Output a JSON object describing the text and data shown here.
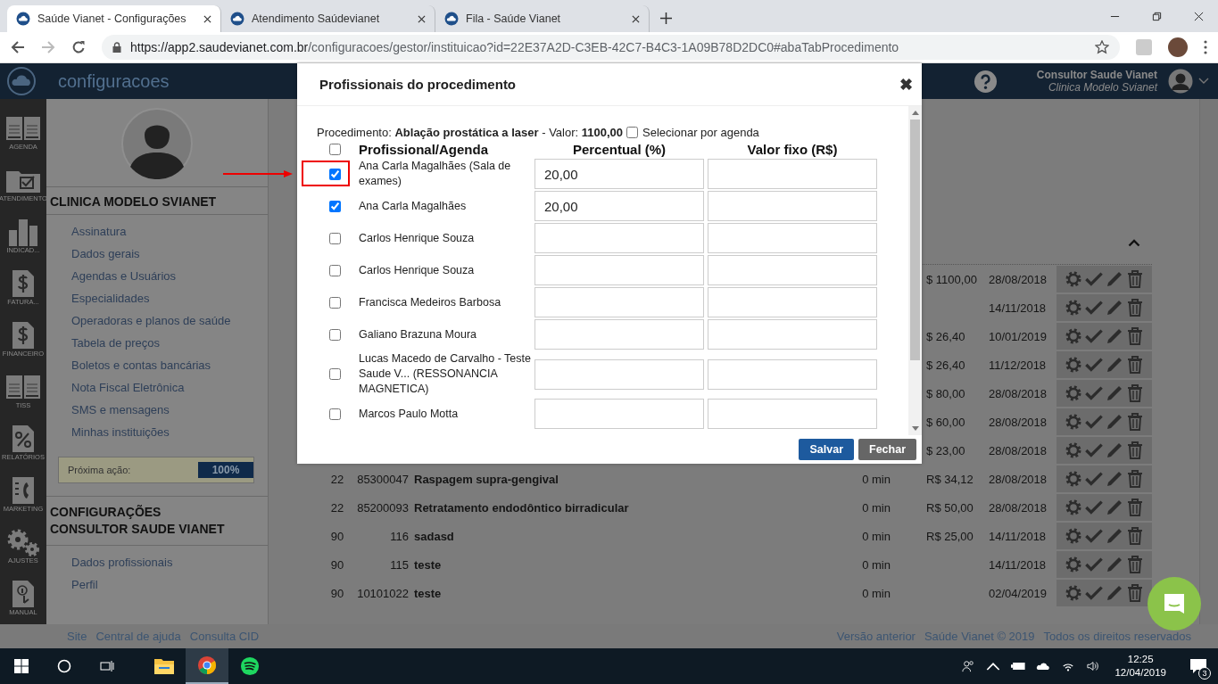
{
  "browser": {
    "tabs": [
      {
        "title": "Saúde Vianet - Configurações",
        "selected": true
      },
      {
        "title": "Atendimento Saúdevianet",
        "selected": false
      },
      {
        "title": "Fila - Saúde Vianet",
        "selected": false
      }
    ],
    "url_host": "https://app2.saudevianet.com.br",
    "url_path": "/configuracoes/gestor/instituicao?id=22E37A2D-C3EB-42C7-B4C3-1A09B78D2DC0#abaTabProcedimento"
  },
  "header": {
    "title": "configuracoes",
    "user_name": "Consultor Saude Vianet",
    "user_clinic": "Clinica Modelo Svianet"
  },
  "icon_nav": [
    {
      "label": "AGENDA",
      "kind": "calendar"
    },
    {
      "label": "ATENDIMENTO",
      "kind": "folder"
    },
    {
      "label": "INDICAD...",
      "kind": "chart"
    },
    {
      "label": "FATURA...",
      "kind": "dollar"
    },
    {
      "label": "FINANCEIRO",
      "kind": "dollar"
    },
    {
      "label": "TISS",
      "kind": "calendar"
    },
    {
      "label": "RELATÓRIOS",
      "kind": "percent"
    },
    {
      "label": "MARKETING",
      "kind": "phone"
    },
    {
      "label": "AJUSTES",
      "kind": "gears"
    },
    {
      "label": "MANUAL",
      "kind": "info"
    }
  ],
  "menu": {
    "clinic_title": "CLINICA MODELO SVIANET",
    "links": [
      "Assinatura",
      "Dados gerais",
      "Agendas e Usuários",
      "Especialidades",
      "Operadoras e planos de saúde",
      "Tabela de preços",
      "Boletos e contas bancárias",
      "Nota Fiscal Eletrônica",
      "SMS e mensagens",
      "Minhas instituições"
    ],
    "progress": {
      "label": "Próxima ação:",
      "level": 1,
      "reading": "100%"
    },
    "user_title_lines": [
      "CONFIGURAÇÕES",
      "CONSULTOR SAUDE VIANET"
    ],
    "user_links": [
      "Dados profissionais",
      "Perfil"
    ]
  },
  "table": {
    "rows": [
      {
        "price": "$ 1100,00",
        "date": "28/08/2018"
      },
      {
        "date": "14/11/2018"
      },
      {
        "price": "$ 26,40",
        "date": "10/01/2019"
      },
      {
        "price": "$ 26,40",
        "date": "11/12/2018"
      },
      {
        "price": "$ 80,00",
        "date": "28/08/2018"
      },
      {
        "price": "$ 60,00",
        "date": "28/08/2018"
      },
      {
        "price": "$ 23,00",
        "date": "28/08/2018"
      },
      {
        "col_1": "22",
        "code": "85300047",
        "name": "Raspagem supra-gengival",
        "duration": "0 min",
        "price": "R$ 34,12",
        "date": "28/08/2018"
      },
      {
        "col_1": "22",
        "code": "85200093",
        "name": "Retratamento endodôntico birradicular",
        "duration": "0 min",
        "price": "R$ 50,00",
        "date": "28/08/2018"
      },
      {
        "col_1": "90",
        "code": "116",
        "name": "sadasd",
        "duration": "0 min",
        "price": "R$ 25,00",
        "date": "14/11/2018"
      },
      {
        "col_1": "90",
        "code": "115",
        "name": "teste",
        "duration": "0 min",
        "date": "14/11/2018"
      },
      {
        "col_1": "90",
        "code": "10101022",
        "name": "teste",
        "duration": "0 min",
        "date": "02/04/2019"
      }
    ]
  },
  "footer": {
    "left_links": [
      "Site",
      "Central de ajuda",
      "Consulta CID"
    ],
    "right_links": [
      "Versão anterior",
      "Saúde Vianet © 2019",
      "Todos os direitos reservados"
    ]
  },
  "modal": {
    "title": "Profissionais do procedimento",
    "close": "✖",
    "procedure_line": "Procedimento: **Ablação prostática a laser** - Valor: **1100,00**",
    "select_by_agenda": {
      "label": "Selecionar por agenda",
      "checked": false
    },
    "select_all_checked": false,
    "columns": [
      "Profissional/Agenda",
      "Percentual (%)",
      "Valor fixo (R$)"
    ],
    "rows": [
      {
        "name": "Ana Carla Magalhães (Sala de exames)",
        "checked": true,
        "percent": "20,00",
        "highlighted": true
      },
      {
        "name": "Ana Carla Magalhães",
        "checked": true,
        "percent": "20,00",
        "highlighted": false
      },
      {
        "name": "Carlos Henrique Souza",
        "checked": false,
        "highlighted": false
      },
      {
        "name": "Carlos Henrique Souza",
        "checked": false,
        "highlighted": false
      },
      {
        "name": "Francisca Medeiros Barbosa",
        "checked": false,
        "highlighted": false
      },
      {
        "name": "Galiano Brazuna Moura",
        "checked": false,
        "highlighted": false
      },
      {
        "name": "Lucas Macedo de Carvalho - Teste Saude V... (RESSONANCIA MAGNETICA)",
        "checked": false,
        "highlighted": false
      },
      {
        "name": "Marcos Paulo Motta",
        "checked": false,
        "highlighted": false
      }
    ],
    "buttons": [
      {
        "label": "Salvar",
        "kind": "primary"
      },
      {
        "label": "Fechar",
        "kind": "secondary"
      }
    ]
  },
  "taskbar": {
    "apps": [
      {
        "kind": "explorer",
        "selected": false
      },
      {
        "kind": "chrome",
        "selected": true
      },
      {
        "kind": "spotify",
        "selected": false
      }
    ],
    "time": "12:25",
    "date": "12/04/2019",
    "notifications": "3"
  }
}
